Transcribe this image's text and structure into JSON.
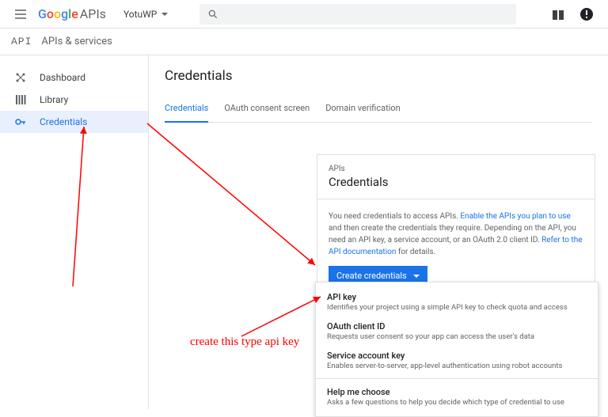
{
  "header": {
    "logo_apis": "APIs",
    "project_name": "YotuWP"
  },
  "subheader": {
    "icon_text": "API",
    "title": "APIs & services"
  },
  "sidebar": {
    "items": [
      {
        "label": "Dashboard"
      },
      {
        "label": "Library"
      },
      {
        "label": "Credentials"
      }
    ]
  },
  "main": {
    "page_title": "Credentials",
    "tabs": [
      {
        "label": "Credentials"
      },
      {
        "label": "OAuth consent screen"
      },
      {
        "label": "Domain verification"
      }
    ]
  },
  "card": {
    "sup": "APIs",
    "title": "Credentials",
    "text_before": "You need credentials to access APIs. ",
    "link1": "Enable the APIs you plan to use",
    "text_mid": " and then create the credentials they require. Depending on the API, you need an API key, a service account, or an OAuth 2.0 client ID. ",
    "link2": "Refer to the API documentation",
    "text_after": " for details.",
    "button": "Create credentials"
  },
  "dropdown": {
    "items": [
      {
        "title": "API key",
        "desc": "Identifies your project using a simple API key to check quota and access"
      },
      {
        "title": "OAuth client ID",
        "desc": "Requests user consent so your app can access the user's data"
      },
      {
        "title": "Service account key",
        "desc": "Enables server-to-server, app-level authentication using robot accounts"
      }
    ],
    "help": {
      "title": "Help me choose",
      "desc": "Asks a few questions to help you decide which type of credential to use"
    }
  },
  "annotation": {
    "text": "create this type api key"
  }
}
